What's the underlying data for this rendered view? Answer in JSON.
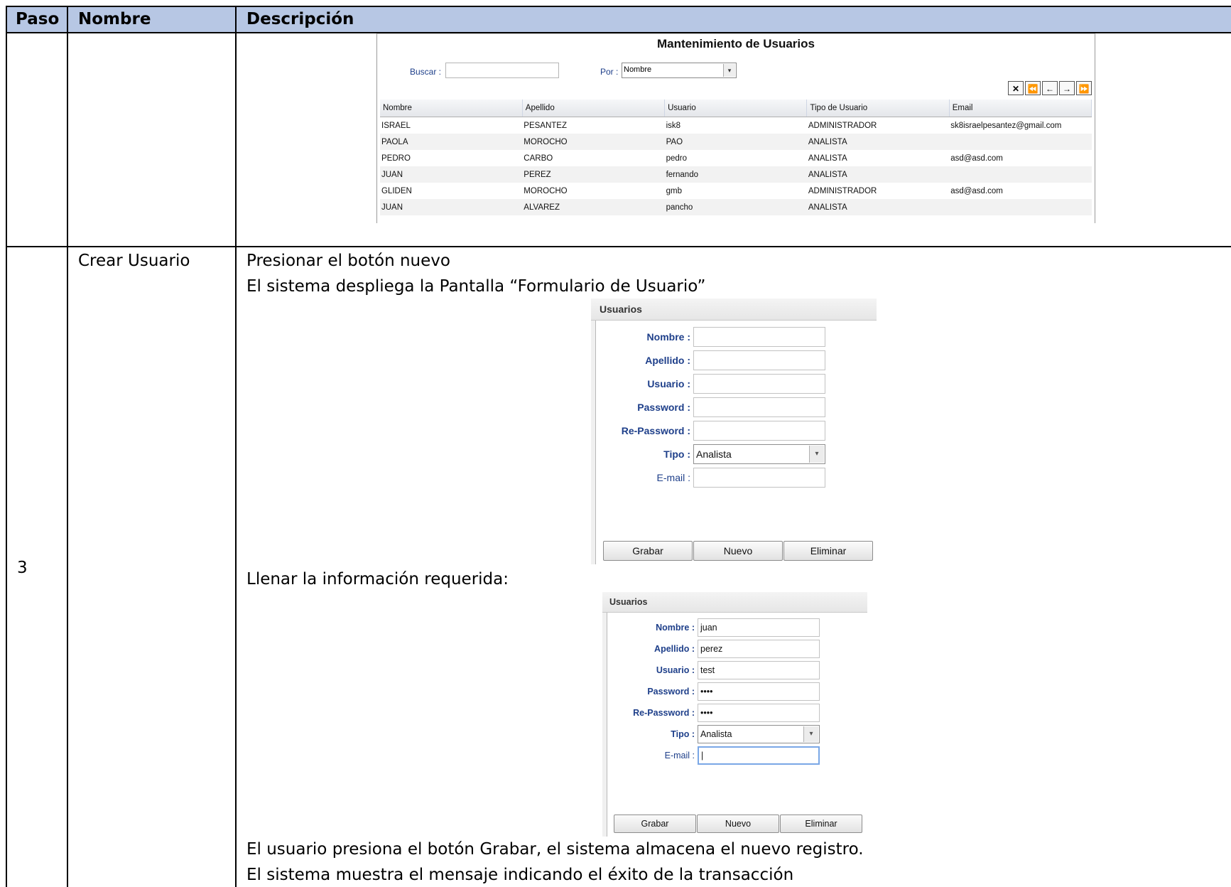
{
  "table": {
    "headers": {
      "paso": "Paso",
      "nombre": "Nombre",
      "descripcion": "Descripción"
    },
    "row_step": {
      "paso": "3",
      "nombre": "Crear Usuario"
    }
  },
  "text": {
    "line1": "Presionar el botón nuevo",
    "line2": "El sistema despliega la Pantalla “Formulario de Usuario”",
    "line3": "Llenar la información requerida:",
    "line4": "El usuario presiona el botón Grabar, el sistema almacena el nuevo registro.",
    "line5": "El sistema muestra el mensaje indicando el éxito de la transacción"
  },
  "mantenimiento": {
    "title": "Mantenimiento de Usuarios",
    "buscar_label": "Buscar :",
    "buscar_value": "",
    "por_label": "Por :",
    "por_value": "Nombre",
    "nav_icons": [
      "close-icon",
      "first-page-icon",
      "prev-page-icon",
      "next-page-icon",
      "last-page-icon"
    ],
    "nav_glyphs": [
      "✕",
      "⏪",
      "←",
      "→",
      "⏩"
    ],
    "columns": [
      "Nombre",
      "Apellido",
      "Usuario",
      "Tipo de Usuario",
      "Email"
    ],
    "rows": [
      [
        "ISRAEL",
        "PESANTEZ",
        "isk8",
        "ADMINISTRADOR",
        "sk8israelpesantez@gmail.com"
      ],
      [
        "PAOLA",
        "MOROCHO",
        "PAO",
        "ANALISTA",
        ""
      ],
      [
        "PEDRO",
        "CARBO",
        "pedro",
        "ANALISTA",
        "asd@asd.com"
      ],
      [
        "JUAN",
        "PEREZ",
        "fernando",
        "ANALISTA",
        ""
      ],
      [
        "GLIDEN",
        "MOROCHO",
        "gmb",
        "ADMINISTRADOR",
        "asd@asd.com"
      ],
      [
        "JUAN",
        "ALVAREZ",
        "pancho",
        "ANALISTA",
        ""
      ]
    ]
  },
  "form_empty": {
    "title": "Usuarios",
    "labels": {
      "nombre": "Nombre :",
      "apellido": "Apellido :",
      "usuario": "Usuario :",
      "password": "Password :",
      "repassword": "Re-Password :",
      "tipo": "Tipo :",
      "email": "E-mail :"
    },
    "values": {
      "nombre": "",
      "apellido": "",
      "usuario": "",
      "password": "",
      "repassword": "",
      "tipo": "Analista",
      "email": ""
    },
    "buttons": {
      "grabar": "Grabar",
      "nuevo": "Nuevo",
      "eliminar": "Eliminar"
    }
  },
  "form_filled": {
    "title": "Usuarios",
    "labels": {
      "nombre": "Nombre :",
      "apellido": "Apellido :",
      "usuario": "Usuario :",
      "password": "Password :",
      "repassword": "Re-Password :",
      "tipo": "Tipo :",
      "email": "E-mail :"
    },
    "values": {
      "nombre": "juan",
      "apellido": "perez",
      "usuario": "test",
      "password": "••••",
      "repassword": "••••",
      "tipo": "Analista",
      "email": "|"
    },
    "buttons": {
      "grabar": "Grabar",
      "nuevo": "Nuevo",
      "eliminar": "Eliminar"
    }
  }
}
